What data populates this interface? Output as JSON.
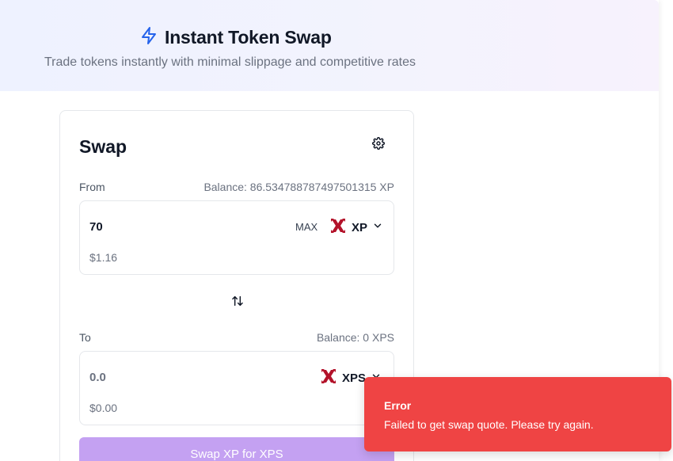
{
  "header": {
    "title": "Instant Token Swap",
    "subtitle": "Trade tokens instantly with minimal slippage and competitive rates",
    "title_icon": "lightning-icon"
  },
  "swap_card": {
    "title": "Swap",
    "settings_icon": "gear-icon",
    "from": {
      "label": "From",
      "balance": "Balance: 86.534788787497501315 XP",
      "amount": "70",
      "usd_value": "$1.16",
      "max_label": "MAX",
      "token_symbol": "XP",
      "token_icon": "token-x-logo-icon"
    },
    "switch_icon": "swap-arrows-icon",
    "to": {
      "label": "To",
      "balance": "Balance: 0 XPS",
      "amount_placeholder": "0.0",
      "usd_value": "$0.00",
      "token_symbol": "XPS",
      "token_icon": "token-x-logo-icon"
    },
    "submit_label": "Swap XP for XPS"
  },
  "toast": {
    "title": "Error",
    "message": "Failed to get swap quote. Please try again."
  },
  "colors": {
    "accent_blue": "#2563eb",
    "button_purple_disabled": "#c4a1f2",
    "error_red": "#ef4444",
    "token_red": "#b3122a"
  }
}
